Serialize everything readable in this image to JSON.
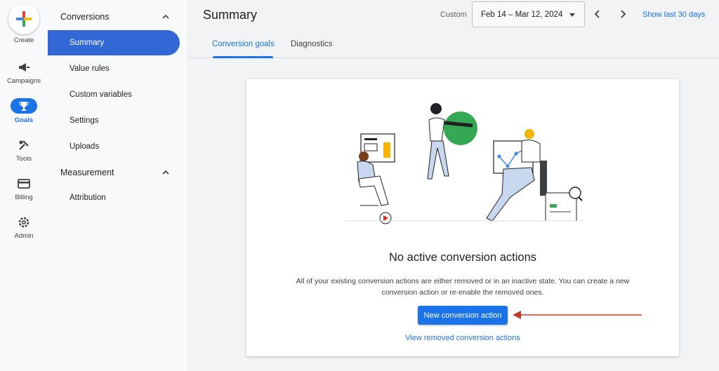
{
  "rail": {
    "create_label": "Create",
    "items": [
      {
        "label": "Campaigns",
        "icon": "megaphone-icon"
      },
      {
        "label": "Goals",
        "icon": "trophy-icon",
        "active": true
      },
      {
        "label": "Tools",
        "icon": "tools-icon"
      },
      {
        "label": "Billing",
        "icon": "credit-card-icon"
      },
      {
        "label": "Admin",
        "icon": "gear-icon"
      }
    ]
  },
  "nav": {
    "sections": [
      {
        "label": "Conversions",
        "items": [
          "Summary",
          "Value rules",
          "Custom variables",
          "Settings",
          "Uploads"
        ]
      },
      {
        "label": "Measurement",
        "items": [
          "Attribution"
        ]
      }
    ],
    "active_item": "Summary"
  },
  "header": {
    "title": "Summary",
    "custom_label": "Custom",
    "date_range": "Feb 14 – Mar 12, 2024",
    "show_last": "Show last 30 days"
  },
  "tabs": [
    {
      "label": "Conversion goals",
      "active": true
    },
    {
      "label": "Diagnostics",
      "active": false
    }
  ],
  "card": {
    "heading": "No active conversion actions",
    "description": "All of your existing conversion actions are either removed or in an inactive state. You can create a new conversion action or re-enable the removed ones.",
    "primary_button": "New conversion action",
    "secondary_link": "View removed conversion actions"
  },
  "colors": {
    "accent": "#1a73e8",
    "nav_active": "#3367d6",
    "annotation_arrow": "#c0392b"
  }
}
